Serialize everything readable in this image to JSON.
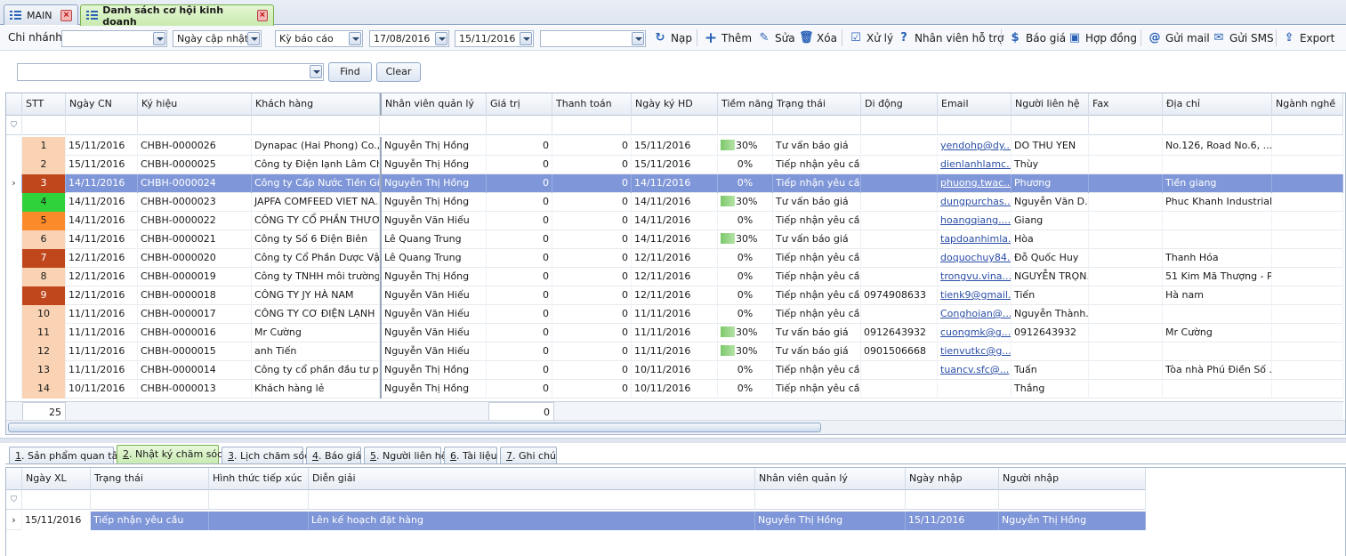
{
  "tabs": [
    {
      "label": "MAIN"
    },
    {
      "label": "Danh sách cơ hội kinh doanh"
    }
  ],
  "toolbar": {
    "branch_label": "Chi nhánh",
    "branch_value": "",
    "date_type": "Ngày cập nhật",
    "period": "Kỳ báo cáo",
    "date_from": "17/08/2016",
    "date_to": "15/11/2016",
    "extra_value": "",
    "buttons": {
      "reload": "Nạp",
      "add": "Thêm",
      "edit": "Sửa",
      "delete": "Xóa",
      "process": "Xử lý",
      "support": "Nhân viên hỗ trợ",
      "quote": "Báo giá",
      "contract": "Hợp đồng",
      "mail": "Gửi mail",
      "sms": "Gửi SMS",
      "export": "Export"
    }
  },
  "find": {
    "value": "",
    "find_label": "Find",
    "clear_label": "Clear"
  },
  "grid": {
    "headers": [
      "STT",
      "Ngày CN",
      "Ký hiệu",
      "Khách hàng",
      "Nhân viên quản lý",
      "Giá trị",
      "Thanh toán",
      "Ngày ký HD",
      "Tiềm năng",
      "Trạng thái",
      "Di động",
      "Email",
      "Người liên hệ",
      "Fax",
      "Địa chỉ",
      "Ngành nghề"
    ],
    "rows": [
      {
        "stt": "1",
        "color": "#f9d3b4",
        "date": "15/11/2016",
        "code": "CHBH-0000026",
        "customer": "Dynapac (Hai Phong) Co., ...",
        "staff": "Nguyễn Thị Hồng",
        "value": "0",
        "paid": "0",
        "signed": "15/11/2016",
        "potential": "30%",
        "bar": true,
        "status": "Tư vấn báo giá",
        "mobile": "",
        "email": "yendohp@dy...",
        "contact": "DO THU YEN",
        "fax": "",
        "address": "No.126, Road No.6, ...",
        "industry": ""
      },
      {
        "stt": "2",
        "color": "#f9d3b4",
        "date": "15/11/2016",
        "code": "CHBH-0000025",
        "customer": "Công ty Điện lạnh Lâm Ch...",
        "staff": "Nguyễn Thị Hồng",
        "value": "0",
        "paid": "0",
        "signed": "15/11/2016",
        "potential": "0%",
        "bar": false,
        "status": "Tiếp nhận yêu cầu",
        "mobile": "",
        "email": "dienlanhlamc...",
        "contact": "Thùy",
        "fax": "",
        "address": "",
        "industry": ""
      },
      {
        "stt": "3",
        "color": "#c0461b",
        "date": "14/11/2016",
        "code": "CHBH-0000024",
        "customer": "Công ty Cấp Nước Tiền Gi...",
        "staff": "Nguyễn Thị Hồng",
        "value": "0",
        "paid": "0",
        "signed": "14/11/2016",
        "potential": "0%",
        "bar": false,
        "status": "Tiếp nhận yêu cầu",
        "mobile": "",
        "email": "phuong.twac...",
        "contact": "Phương",
        "fax": "",
        "address": "Tiền giang",
        "industry": "",
        "selected": true
      },
      {
        "stt": "4",
        "color": "#2fd23a",
        "date": "14/11/2016",
        "code": "CHBH-0000023",
        "customer": "JAPFA COMFEED VIET NA...",
        "staff": "Nguyễn Thị Hồng",
        "value": "0",
        "paid": "0",
        "signed": "14/11/2016",
        "potential": "30%",
        "bar": true,
        "status": "Tư vấn báo giá",
        "mobile": "",
        "email": "dungpurchas...",
        "contact": "Nguyễn Văn D...",
        "fax": "",
        "address": "Phuc Khanh Industrial ...",
        "industry": ""
      },
      {
        "stt": "5",
        "color": "#fb8a2a",
        "date": "14/11/2016",
        "code": "CHBH-0000022",
        "customer": "CÔNG TY  CỔ PHẦN THƯƠ...",
        "staff": "Nguyễn Văn Hiếu",
        "value": "0",
        "paid": "0",
        "signed": "14/11/2016",
        "potential": "0%",
        "bar": false,
        "status": "Tiếp nhận yêu cầu",
        "mobile": "",
        "email": "hoangqiang....",
        "contact": "Giang",
        "fax": "",
        "address": "",
        "industry": ""
      },
      {
        "stt": "6",
        "color": "#f9d3b4",
        "date": "14/11/2016",
        "code": "CHBH-0000021",
        "customer": "Công ty Số 6 Điện Biên",
        "staff": "Lê Quang Trung",
        "value": "0",
        "paid": "0",
        "signed": "14/11/2016",
        "potential": "30%",
        "bar": true,
        "status": "Tư vấn báo giá",
        "mobile": "",
        "email": "tapdoanhimla...",
        "contact": "Hòa",
        "fax": "",
        "address": "",
        "industry": ""
      },
      {
        "stt": "7",
        "color": "#c0461b",
        "date": "12/11/2016",
        "code": "CHBH-0000020",
        "customer": "Công ty Cổ Phần Dược Vật...",
        "staff": "Lê Quang Trung",
        "value": "0",
        "paid": "0",
        "signed": "12/11/2016",
        "potential": "0%",
        "bar": false,
        "status": "Tiếp nhận yêu cầu",
        "mobile": "",
        "email": "doquochuy84...",
        "contact": "Đỗ Quốc Huy",
        "fax": "",
        "address": "Thanh Hóa",
        "industry": ""
      },
      {
        "stt": "8",
        "color": "#f9d3b4",
        "date": "12/11/2016",
        "code": "CHBH-0000019",
        "customer": "Công ty TNHH môi trường ...",
        "staff": "Nguyễn Thị Hồng",
        "value": "0",
        "paid": "0",
        "signed": "12/11/2016",
        "potential": "0%",
        "bar": false,
        "status": "Tiếp nhận yêu cầu",
        "mobile": "",
        "email": "trongvu.vina...",
        "contact": "NGUYỄN TRỌN...",
        "fax": "",
        "address": "51 Kim Mã Thượng - P...",
        "industry": ""
      },
      {
        "stt": "9",
        "color": "#c0461b",
        "date": "12/11/2016",
        "code": "CHBH-0000018",
        "customer": "CÔNG TY JY HÀ NAM",
        "staff": "Nguyễn Văn Hiếu",
        "value": "0",
        "paid": "0",
        "signed": "12/11/2016",
        "potential": "0%",
        "bar": false,
        "status": "Tiếp nhận yêu cầu",
        "mobile": "0974908633",
        "email": "tienk9@gmail...",
        "contact": "Tiến",
        "fax": "",
        "address": "Hà nam",
        "industry": ""
      },
      {
        "stt": "10",
        "color": "#f9d3b4",
        "date": "11/11/2016",
        "code": "CHBH-0000017",
        "customer": "CÔNG TY CƠ ĐIỆN LẠNH ...",
        "staff": "Nguyễn Văn Hiếu",
        "value": "0",
        "paid": "0",
        "signed": "11/11/2016",
        "potential": "0%",
        "bar": false,
        "status": "Tiếp nhận yêu cầu",
        "mobile": "",
        "email": "Conghoian@...",
        "contact": "Nguyễn Thành...",
        "fax": "",
        "address": "",
        "industry": ""
      },
      {
        "stt": "11",
        "color": "#f9d3b4",
        "date": "11/11/2016",
        "code": "CHBH-0000016",
        "customer": "Mr Cường",
        "staff": "Nguyễn Văn Hiếu",
        "value": "0",
        "paid": "0",
        "signed": "11/11/2016",
        "potential": "30%",
        "bar": true,
        "status": "Tư vấn báo giá",
        "mobile": "0912643932",
        "email": "cuongmk@g...",
        "contact": "0912643932",
        "fax": "",
        "address": "Mr Cường",
        "industry": ""
      },
      {
        "stt": "12",
        "color": "#f9d3b4",
        "date": "11/11/2016",
        "code": "CHBH-0000015",
        "customer": "anh Tiến",
        "staff": "Nguyễn Văn Hiếu",
        "value": "0",
        "paid": "0",
        "signed": "11/11/2016",
        "potential": "30%",
        "bar": true,
        "status": "Tư vấn báo giá",
        "mobile": "0901506668",
        "email": "tienvutkc@g...",
        "contact": "",
        "fax": "",
        "address": "",
        "industry": ""
      },
      {
        "stt": "13",
        "color": "#f9d3b4",
        "date": "11/11/2016",
        "code": "CHBH-0000014",
        "customer": "Công ty cổ phần đầu tư p...",
        "staff": "Nguyễn Thị Hồng",
        "value": "0",
        "paid": "0",
        "signed": "10/11/2016",
        "potential": "0%",
        "bar": false,
        "status": "Tiếp nhận yêu cầu",
        "mobile": "",
        "email": "tuancv.sfc@...",
        "contact": "Tuấn",
        "fax": "",
        "address": "Tòa nhà Phú Điền Số ...",
        "industry": ""
      },
      {
        "stt": "14",
        "color": "#f9d3b4",
        "date": "10/11/2016",
        "code": "CHBH-0000013",
        "customer": "Khách hàng lẻ",
        "staff": "Nguyễn Thị Hồng",
        "value": "0",
        "paid": "0",
        "signed": "10/11/2016",
        "potential": "0%",
        "bar": false,
        "status": "Tiếp nhận yêu cầu",
        "mobile": "",
        "email": "",
        "contact": "Thắng",
        "fax": "",
        "address": "",
        "industry": ""
      }
    ],
    "footer_count": "25",
    "footer_value": "0"
  },
  "subtabs": [
    {
      "key": "1",
      "label": ". Sản phẩm quan tâm"
    },
    {
      "key": "2",
      "label": ". Nhật ký chăm sóc",
      "active": true
    },
    {
      "key": "3",
      "label": ". Lịch chăm sóc"
    },
    {
      "key": "4",
      "label": ". Báo giá"
    },
    {
      "key": "5",
      "label": ". Người liên hệ"
    },
    {
      "key": "6",
      "label": ". Tài liệu"
    },
    {
      "key": "7",
      "label": ". Ghi chú"
    }
  ],
  "care_log": {
    "headers": [
      "Ngày XL",
      "Trạng thái",
      "Hình thức tiếp xúc",
      "Diễn giải",
      "Nhân viên quản lý",
      "Ngày nhập",
      "Người nhập"
    ],
    "rows": [
      {
        "date": "15/11/2016",
        "status": "Tiếp nhận yêu cầu",
        "method": "",
        "description": "Lên kế hoạch đặt hàng",
        "staff": "Nguyễn Thị Hồng",
        "entry_date": "15/11/2016",
        "entered_by": "Nguyễn Thị Hồng"
      }
    ]
  }
}
